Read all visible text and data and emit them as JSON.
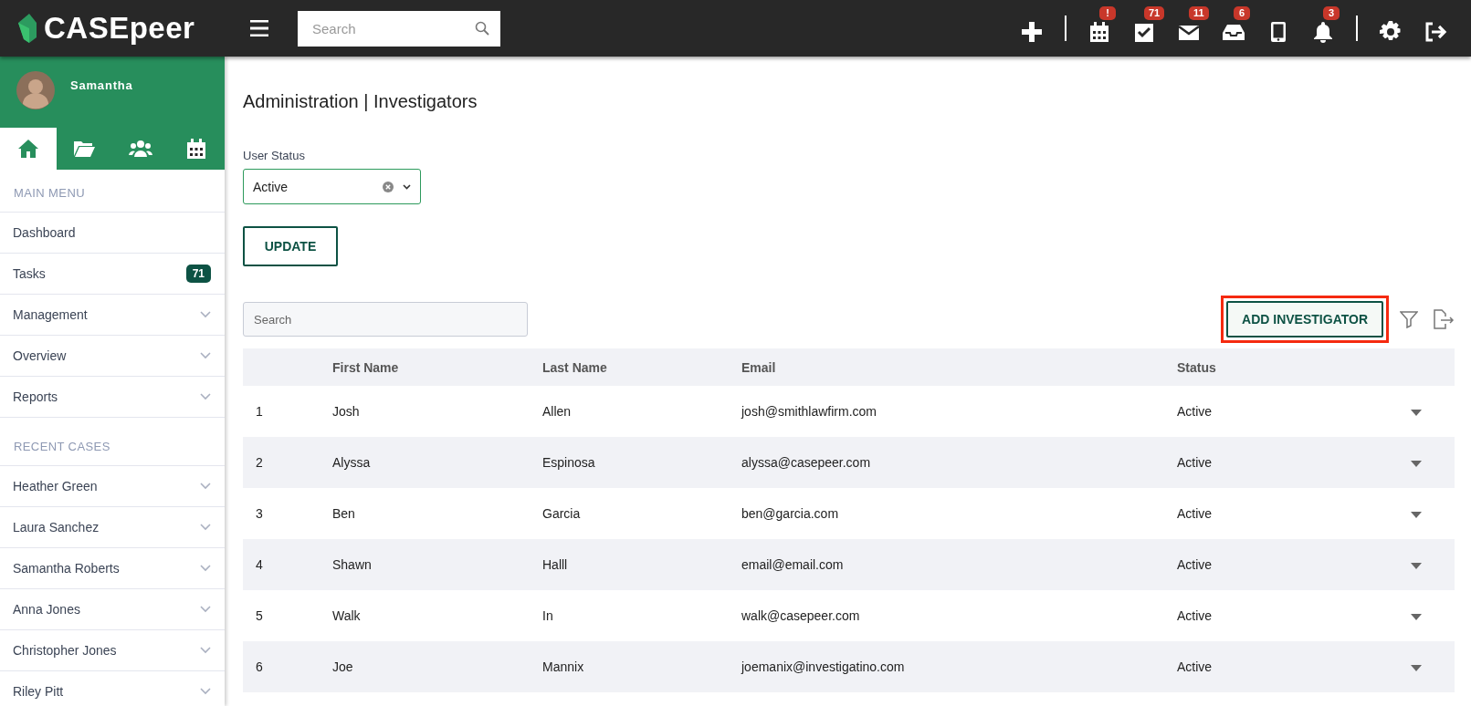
{
  "topbar": {
    "logo": "CASEpeer",
    "search": {
      "placeholder": "Search"
    },
    "action_groups": [
      [
        {
          "kind": "plus"
        }
      ],
      [
        {
          "kind": "calendar",
          "badge": "!"
        },
        {
          "kind": "tasks",
          "badge": "71"
        },
        {
          "kind": "mail",
          "badge": "11"
        },
        {
          "kind": "inbox",
          "badge": "6"
        },
        {
          "kind": "phone"
        },
        {
          "kind": "bell",
          "badge": "3"
        }
      ],
      [
        {
          "kind": "gear"
        },
        {
          "kind": "logout"
        }
      ]
    ]
  },
  "sidebar": {
    "user": {
      "name": "Samantha"
    },
    "tabs": [
      {
        "kind": "home",
        "selected": true
      },
      {
        "kind": "folder",
        "selected": false
      },
      {
        "kind": "users",
        "selected": false
      },
      {
        "kind": "calendar",
        "selected": false
      }
    ],
    "sections": [
      {
        "title": "MAIN MENU",
        "items": [
          {
            "label": "Dashboard",
            "expandable": false
          },
          {
            "label": "Tasks",
            "badge": "71",
            "expandable": false
          },
          {
            "label": "Management",
            "expandable": true
          },
          {
            "label": "Overview",
            "expandable": true
          },
          {
            "label": "Reports",
            "expandable": true
          }
        ]
      },
      {
        "title": "RECENT CASES",
        "items": [
          {
            "label": "Heather Green",
            "expandable": true
          },
          {
            "label": "Laura Sanchez",
            "expandable": true
          },
          {
            "label": "Samantha Roberts",
            "expandable": true
          },
          {
            "label": "Anna Jones",
            "expandable": true
          },
          {
            "label": "Christopher Jones",
            "expandable": true
          },
          {
            "label": "Riley Pitt",
            "expandable": true
          }
        ]
      }
    ]
  },
  "main": {
    "title": "Administration | Investigators",
    "user_status": {
      "label": "User Status",
      "value": "Active"
    },
    "update_button": "UPDATE",
    "search": {
      "placeholder": "Search"
    },
    "add_button": {
      "label": "ADD INVESTIGATOR",
      "highlighted": true
    },
    "table": {
      "columns": [
        "",
        "First Name",
        "Last Name",
        "Email",
        "Status"
      ],
      "rows": [
        [
          "1",
          "Josh",
          "Allen",
          "josh@smithlawfirm.com",
          "Active"
        ],
        [
          "2",
          "Alyssa",
          "Espinosa",
          "alyssa@casepeer.com",
          "Active"
        ],
        [
          "3",
          "Ben",
          "Garcia",
          "ben@garcia.com",
          "Active"
        ],
        [
          "4",
          "Shawn",
          "Halll",
          "email@email.com",
          "Active"
        ],
        [
          "5",
          "Walk",
          "In",
          "walk@casepeer.com",
          "Active"
        ],
        [
          "6",
          "Joe",
          "Mannix",
          "joemanix@investigatino.com",
          "Active"
        ]
      ]
    }
  }
}
